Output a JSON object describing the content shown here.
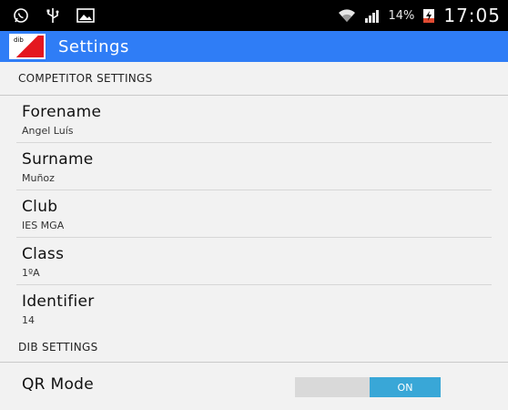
{
  "status_bar": {
    "battery": "14%",
    "time": "17:05",
    "icons": [
      "whatsapp-icon",
      "usb-icon",
      "image-icon",
      "wifi-icon",
      "signal-icon",
      "battery-charging-icon"
    ]
  },
  "action_bar": {
    "logo_text": "dib",
    "title": "Settings",
    "accent_color": "#2f7df6"
  },
  "sections": {
    "competitor": {
      "header": "COMPETITOR SETTINGS",
      "items": [
        {
          "title": "Forename",
          "summary": "Angel Luís"
        },
        {
          "title": "Surname",
          "summary": "Muñoz"
        },
        {
          "title": "Club",
          "summary": "IES MGA"
        },
        {
          "title": "Class",
          "summary": "1ºA"
        },
        {
          "title": "Identifier",
          "summary": "14"
        }
      ]
    },
    "dib": {
      "header": "DIB SETTINGS",
      "qr_mode": {
        "label": "QR Mode",
        "state_label": "ON",
        "enabled": true,
        "on_color": "#39a7d7"
      }
    }
  }
}
